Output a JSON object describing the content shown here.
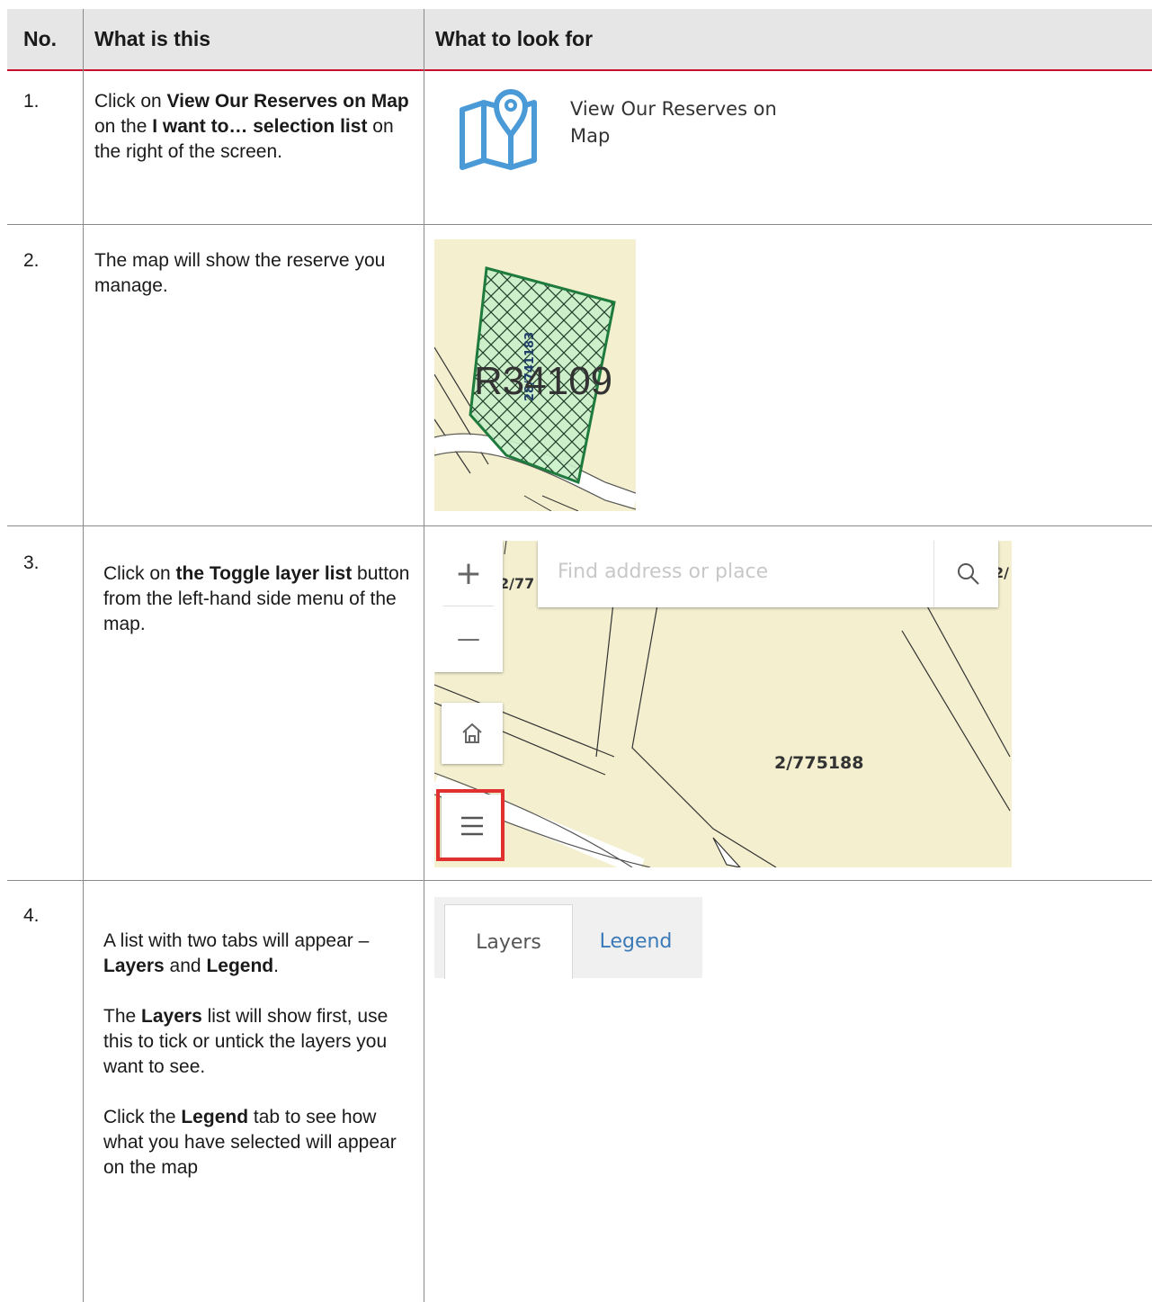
{
  "header": {
    "col_no": "No.",
    "col_what": "What is this",
    "col_look": "What to look for"
  },
  "rows": [
    {
      "num": "1.",
      "media": {
        "label": "View Our Reserves on Map"
      }
    },
    {
      "num": "2.",
      "media": {
        "reserve_code": "R34109",
        "lot_label": "28/741183"
      }
    },
    {
      "num": "3.",
      "media": {
        "search_placeholder": "Find address or place",
        "parcel_label": "2/775188",
        "edge_label_left": "2/77",
        "edge_label_right": "2/",
        "zoom_in": "+",
        "zoom_out": "—"
      }
    },
    {
      "num": "4.",
      "media": {
        "tab_layers": "Layers",
        "tab_legend": "Legend"
      }
    }
  ],
  "text": {
    "r1_a": "Click on ",
    "r1_b": "View Our Reserves on Map",
    "r1_c": " on the ",
    "r1_d": "I want to… selection list",
    "r1_e": " on the right of the screen.",
    "r2": "The map will show the reserve you manage.",
    "r3_a": "Click on ",
    "r3_b": "the Toggle layer list",
    "r3_c": " button from the left-hand side menu of the map.",
    "r4_p1_a": "A list with two tabs will appear – ",
    "r4_p1_b": "Layers",
    "r4_p1_c": " and ",
    "r4_p1_d": "Legend",
    "r4_p1_e": ".",
    "r4_p2_a": "The ",
    "r4_p2_b": "Layers",
    "r4_p2_c": " list will show first, use this to tick or untick the layers you want to see.",
    "r4_p3_a": "Click the ",
    "r4_p3_b": "Legend",
    "r4_p3_c": " tab to see how what you have selected will appear on the map"
  },
  "colors": {
    "header_bg": "#e6e6e6",
    "header_rule": "#c8102e",
    "reserve_fill": "#c9efc9",
    "reserve_stroke": "#1f7a3d",
    "map_bg": "#f3efcf",
    "highlight": "#e03030",
    "link_blue": "#3b7ab8",
    "icon_blue": "#4a9ad8"
  },
  "icons": [
    "map-pin-icon",
    "search-icon",
    "home-icon",
    "layer-list-icon",
    "cursor-arrow-icon"
  ]
}
